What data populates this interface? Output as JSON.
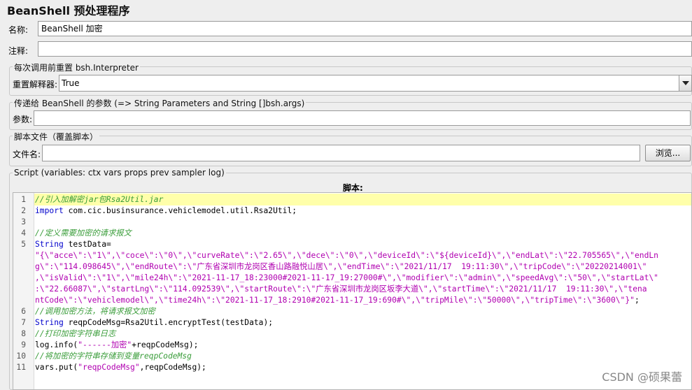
{
  "window_title": "BeanShell 预处理程序",
  "name": {
    "label": "名称:",
    "value": "BeanShell 加密"
  },
  "comment": {
    "label": "注释:",
    "value": ""
  },
  "reset_group": {
    "title": "每次调用前重置 bsh.Interpreter",
    "label": "重置解释器:",
    "selected": "True"
  },
  "params_group": {
    "title": "传递给 BeanShell 的参数 (=> String Parameters and String []bsh.args)",
    "label": "参数:",
    "value": ""
  },
  "file_group": {
    "title": "脚本文件（覆盖脚本）",
    "label": "文件名:",
    "value": "",
    "browse_label": "浏览..."
  },
  "script_group": {
    "title": "Script (variables: ctx vars props prev sampler log)",
    "script_label": "脚本:"
  },
  "code": {
    "line_numbers": [
      "1",
      "2",
      "3",
      "4",
      "5",
      "6",
      "7",
      "8",
      "9",
      "10",
      "11"
    ],
    "lines": [
      [
        {
          "t": "c",
          "s": "//引入加解密jar包Rsa2Util.jar"
        }
      ],
      [
        {
          "t": "k",
          "s": "import"
        },
        {
          "t": "n",
          "s": " com.cic.businsurance.vehiclemodel.util.Rsa2Util;"
        }
      ],
      [
        {
          "t": "n",
          "s": ""
        }
      ],
      [
        {
          "t": "c",
          "s": "//定义需要加密的请求报文"
        }
      ],
      [
        {
          "t": "k",
          "s": "String"
        },
        {
          "t": "n",
          "s": " testData="
        }
      ],
      [
        {
          "t": "s",
          "s": "\"{\\\"acce\\\":\\\"1\\\",\\\"coce\\\":\\\"0\\\",\\\"curveRate\\\":\\\"2.65\\\",\\\"dece\\\":\\\"0\\\",\\\"deviceId\\\":\\\"${deviceId}\\\",\\\"endLat\\\":\\\"22.705565\\\",\\\"endLn"
        }
      ],
      [
        {
          "t": "s",
          "s": "g\\\":\\\"114.098645\\\",\\\"endRoute\\\":\\\"广东省深圳市龙岗区香山路融悦山居\\\",\\\"endTime\\\":\\\"2021/11/17  19:11:30\\\",\\\"tripCode\\\":\\\"20220214001\\\""
        }
      ],
      [
        {
          "t": "s",
          "s": ",\\\"isValid\\\":\\\"1\\\",\\\"mile24h\\\":\\\"2021-11-17_18:23000#2021-11-17_19:27000#\\\",\\\"modifier\\\":\\\"admin\\\",\\\"speedAvg\\\":\\\"50\\\",\\\"startLat\\\""
        }
      ],
      [
        {
          "t": "s",
          "s": ":\\\"22.66087\\\",\\\"startLng\\\":\\\"114.092539\\\",\\\"startRoute\\\":\\\"广东省深圳市龙岗区坂李大道\\\",\\\"startTime\\\":\\\"2021/11/17  19:11:30\\\",\\\"tena"
        }
      ],
      [
        {
          "t": "s",
          "s": "ntCode\\\":\\\"vehiclemodel\\\",\\\"time24h\\\":\\\"2021-11-17_18:2910#2021-11-17_19:690#\\\",\\\"tripMile\\\":\\\"50000\\\",\\\"tripTime\\\":\\\"3600\\\"}\""
        },
        {
          "t": "n",
          "s": ";"
        }
      ],
      [
        {
          "t": "c",
          "s": "//调用加密方法，将请求报文加密"
        }
      ],
      [
        {
          "t": "k",
          "s": "String"
        },
        {
          "t": "n",
          "s": " reqpCodeMsg=Rsa2Util.encryptTest(testData);"
        }
      ],
      [
        {
          "t": "c",
          "s": "//打印加密字符串日志"
        }
      ],
      [
        {
          "t": "n",
          "s": "log.info("
        },
        {
          "t": "s",
          "s": "\"------加密\""
        },
        {
          "t": "n",
          "s": "+reqpCodeMsg);"
        }
      ],
      [
        {
          "t": "c",
          "s": "//将加密的字符串存储到变量reqpCodeMsg"
        }
      ],
      [
        {
          "t": "n",
          "s": "vars.put("
        },
        {
          "t": "s",
          "s": "\"reqpCodeMsg\""
        },
        {
          "t": "n",
          "s": ",reqpCodeMsg);"
        }
      ]
    ],
    "line_number_rows": [
      0,
      1,
      2,
      3,
      4,
      10,
      11,
      12,
      13,
      14,
      15
    ]
  },
  "watermark_text": "CSDN @硕果蕾"
}
